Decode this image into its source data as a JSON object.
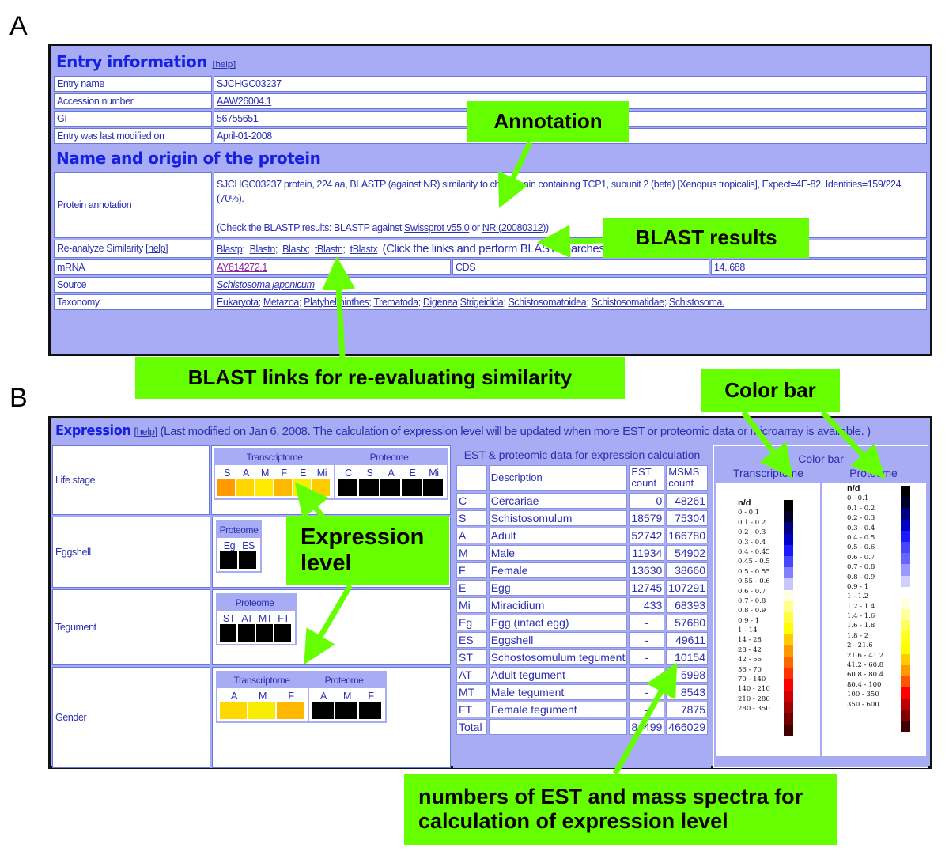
{
  "panels": {
    "a": "A",
    "b": "B"
  },
  "entry": {
    "section_title": "Entry information",
    "help": "[help]",
    "rows": [
      {
        "label": "Entry name",
        "value": "SJCHGC03237"
      },
      {
        "label": "Accession number",
        "value": "AAW26004.1"
      },
      {
        "label": "GI",
        "value": "56755651"
      },
      {
        "label": "Entry was last modified on",
        "value": "April-01-2008"
      }
    ]
  },
  "origin": {
    "section_title": "Name and origin of the protein",
    "protein_annotation_label": "Protein annotation",
    "protein_annotation_text": "SJCHGC03237 protein, 224 aa, BLASTP (against NR) similarity to chaperonin containing TCP1, subunit 2 (beta) [Xenopus tropicalis], Expect=4E-82, Identities=159/224 (70%).",
    "check_prefix": "(Check the BLASTP results: BLASTP against ",
    "swissprot_link": "Swissprot v55.0",
    "or_text": " or ",
    "nr_link": "NR (20080312)",
    "check_suffix": ")",
    "reanalyze_label": "Re-analyze Similarity",
    "reanalyze_help": "[help]",
    "blast_links": [
      "Blastp",
      "Blastn",
      "Blastx",
      "tBlastn",
      "tBlastx"
    ],
    "blast_note": "(Click the links and perform BLAST searches against last databases at NCBI.)",
    "mrna_label": "mRNA",
    "mrna_value": "AY814272.1",
    "cds_label": "CDS",
    "cds_value": "14..688",
    "source_label": "Source",
    "source_value": "Schistosoma japonicum",
    "taxonomy_label": "Taxonomy",
    "taxonomy": [
      "Eukaryota;",
      "Metazoa;",
      "Platyhelminthes;",
      "Trematoda;",
      "Digenea;Strigeidida;",
      "Schistosomatoidea;",
      "Schistosomatidae;",
      "Schistosoma."
    ]
  },
  "expression": {
    "title": "Expression",
    "help": "[help]",
    "note": "(Last modified on Jan 6, 2008. The calculation of expression level will be updated when more EST or proteomic data or microarray is available. )",
    "life_stage": {
      "label": "Life stage",
      "transcriptome_label": "Transcriptome",
      "proteome_label": "Proteome",
      "transcriptome": [
        {
          "key": "S",
          "color": "#ff9a00"
        },
        {
          "key": "A",
          "color": "#ffd600"
        },
        {
          "key": "M",
          "color": "#ffea00"
        },
        {
          "key": "F",
          "color": "#ffb800"
        },
        {
          "key": "E",
          "color": "#f4f000"
        },
        {
          "key": "Mi",
          "color": "#ffcc00"
        }
      ],
      "proteome": [
        {
          "key": "C",
          "color": "#000000"
        },
        {
          "key": "S",
          "color": "#000000"
        },
        {
          "key": "A",
          "color": "#000000"
        },
        {
          "key": "E",
          "color": "#000000"
        },
        {
          "key": "Mi",
          "color": "#000000"
        }
      ]
    },
    "eggshell": {
      "label": "Eggshell",
      "proteome_label": "Proteome",
      "proteome": [
        {
          "key": "Eg",
          "color": "#000000"
        },
        {
          "key": "ES",
          "color": "#000000"
        }
      ]
    },
    "tegument": {
      "label": "Tegument",
      "proteome_label": "Proteome",
      "proteome": [
        {
          "key": "ST",
          "color": "#000000"
        },
        {
          "key": "AT",
          "color": "#000000"
        },
        {
          "key": "MT",
          "color": "#000000"
        },
        {
          "key": "FT",
          "color": "#000000"
        }
      ]
    },
    "gender": {
      "label": "Gender",
      "transcriptome_label": "Transcriptome",
      "proteome_label": "Proteome",
      "transcriptome": [
        {
          "key": "A",
          "color": "#ffd800"
        },
        {
          "key": "M",
          "color": "#f8ec00"
        },
        {
          "key": "F",
          "color": "#ffb800"
        }
      ],
      "proteome": [
        {
          "key": "A",
          "color": "#000000"
        },
        {
          "key": "M",
          "color": "#000000"
        },
        {
          "key": "F",
          "color": "#000000"
        }
      ]
    },
    "est_table": {
      "caption": "EST & proteomic data for expression calculation",
      "headers": [
        "",
        "Description",
        "EST count",
        "MSMS count"
      ],
      "rows": [
        [
          "C",
          "Cercariae",
          "0",
          "48261"
        ],
        [
          "S",
          "Schistosomulum",
          "18579",
          "75304"
        ],
        [
          "A",
          "Adult",
          "52742",
          "166780"
        ],
        [
          "M",
          "Male",
          "11934",
          "54902"
        ],
        [
          "F",
          "Female",
          "13630",
          "38660"
        ],
        [
          "E",
          "Egg",
          "12745",
          "107291"
        ],
        [
          "Mi",
          "Miracidium",
          "433",
          "68393"
        ],
        [
          "Eg",
          "Egg (intact egg)",
          "-",
          "57680"
        ],
        [
          "ES",
          "Eggshell",
          "-",
          "49611"
        ],
        [
          "ST",
          "Schostosomulum tegument",
          "-",
          "10154"
        ],
        [
          "AT",
          "Adult tegument",
          "-",
          "5998"
        ],
        [
          "MT",
          "Male tegument",
          "-",
          "8543"
        ],
        [
          "FT",
          "Female tegument",
          "-",
          "7875"
        ],
        [
          "Total",
          "",
          "84499",
          "466029"
        ]
      ]
    },
    "color_bar": {
      "caption": "Color bar",
      "transcriptome_label": "Transcriptome",
      "proteome_label": "Proteome",
      "nd_label": "n/d",
      "transcriptome_ranges": [
        {
          "label": "0 - 0.1",
          "color": "#000000"
        },
        {
          "label": "0.1 - 0.2",
          "color": "#00002a"
        },
        {
          "label": "0.2 - 0.3",
          "color": "#000080"
        },
        {
          "label": "0.3 - 0.4",
          "color": "#0000c8"
        },
        {
          "label": "0.4 - 0.45",
          "color": "#1a1aff"
        },
        {
          "label": "0.45 - 0.5",
          "color": "#4646ff"
        },
        {
          "label": "0.5 - 0.55",
          "color": "#8080ff"
        },
        {
          "label": "0.55 - 0.6",
          "color": "#c8c8ff"
        },
        {
          "label": "0.6 - 0.7",
          "color": "#ffffe0"
        },
        {
          "label": "0.7 - 0.8",
          "color": "#ffff90"
        },
        {
          "label": "0.8 - 0.9",
          "color": "#ffff40"
        },
        {
          "label": "0.9 - 1",
          "color": "#ffff00"
        },
        {
          "label": "1 - 14",
          "color": "#ffcc00"
        },
        {
          "label": "14 - 28",
          "color": "#ff9900"
        },
        {
          "label": "28 - 42",
          "color": "#ff6600"
        },
        {
          "label": "42 - 56",
          "color": "#ff3300"
        },
        {
          "label": "56 - 70",
          "color": "#ff0000"
        },
        {
          "label": "70 - 140",
          "color": "#d00000"
        },
        {
          "label": "140 - 210",
          "color": "#a00000"
        },
        {
          "label": "210 - 280",
          "color": "#700000"
        },
        {
          "label": "280 - 350",
          "color": "#400000"
        }
      ],
      "proteome_ranges": [
        {
          "label": "0 - 0.1",
          "color": "#000000"
        },
        {
          "label": "0.1 - 0.2",
          "color": "#00002a"
        },
        {
          "label": "0.2 - 0.3",
          "color": "#000080"
        },
        {
          "label": "0.3 - 0.4",
          "color": "#0000c8"
        },
        {
          "label": "0.4 - 0.5",
          "color": "#1a1aff"
        },
        {
          "label": "0.5 - 0.6",
          "color": "#4646ff"
        },
        {
          "label": "0.6 - 0.7",
          "color": "#6666ff"
        },
        {
          "label": "0.7 - 0.8",
          "color": "#9999ff"
        },
        {
          "label": "0.8 - 0.9",
          "color": "#d0d0ff"
        },
        {
          "label": "0.9 - 1",
          "color": "#ffffff"
        },
        {
          "label": "1 - 1.2",
          "color": "#ffffe0"
        },
        {
          "label": "1.2 - 1.4",
          "color": "#ffffa0"
        },
        {
          "label": "1.4 - 1.6",
          "color": "#ffff60"
        },
        {
          "label": "1.6 - 1.8",
          "color": "#ffff20"
        },
        {
          "label": "1.8 - 2",
          "color": "#ffff00"
        },
        {
          "label": "2 - 21.6",
          "color": "#ffcc00"
        },
        {
          "label": "21.6 - 41.2",
          "color": "#ff9900"
        },
        {
          "label": "41.2 - 60.8",
          "color": "#ff5500"
        },
        {
          "label": "60.8 - 80.4",
          "color": "#ff0000"
        },
        {
          "label": "80.4 - 100",
          "color": "#c00000"
        },
        {
          "label": "100 - 350",
          "color": "#800000"
        },
        {
          "label": "350 - 600",
          "color": "#400000"
        }
      ]
    }
  },
  "callouts": {
    "annotation": "Annotation",
    "blast_results": "BLAST results",
    "blast_links": "BLAST links for re-evaluating similarity",
    "color_bar": "Color bar",
    "expression_level": "Expression level",
    "numbers": "numbers of EST and mass spectra for calculation of expression level"
  },
  "colors": {
    "frame_bg": "#a8acf4",
    "text_blue": "#2a2fb0",
    "callout_green": "#66ff00",
    "date_red": "#e02020"
  }
}
